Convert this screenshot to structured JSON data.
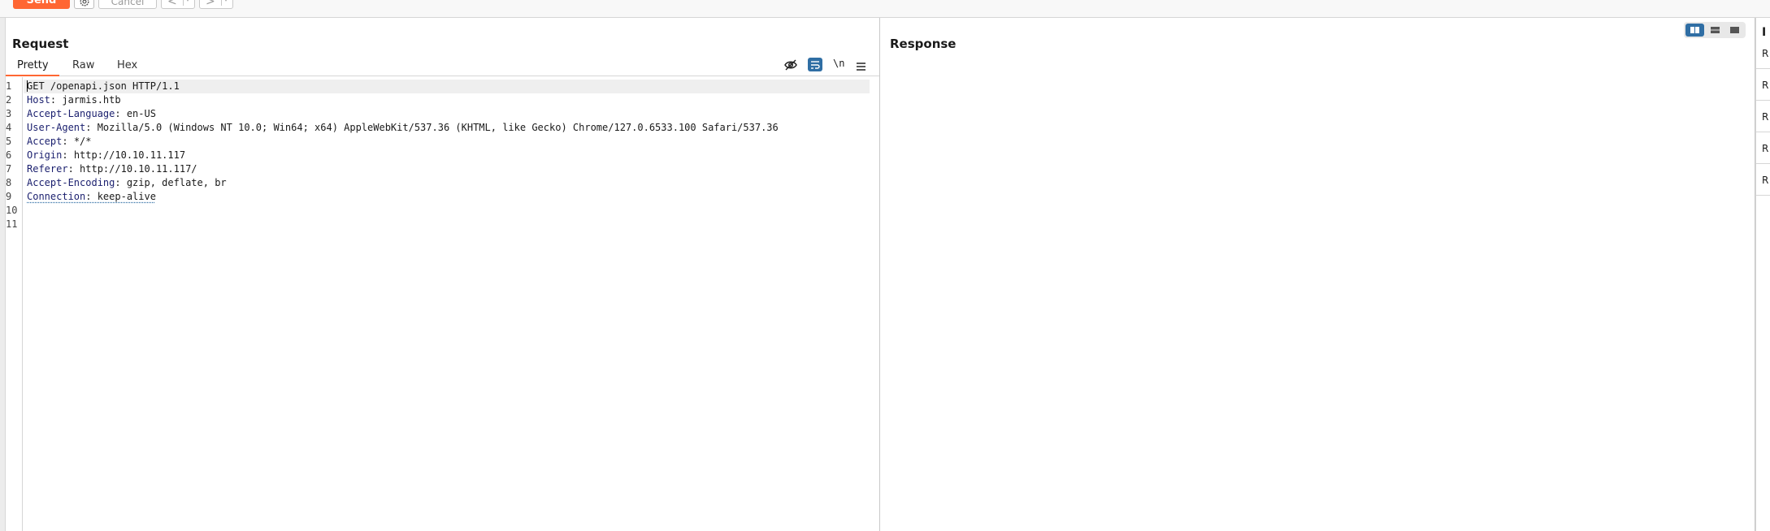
{
  "toolbar": {
    "send_label": "Send",
    "cancel_label": "Cancel",
    "back_glyph": "<",
    "forward_glyph": ">",
    "dropdown_glyph": "▾",
    "settings_icon": "gear-icon",
    "accent_color": "#ff6633"
  },
  "request": {
    "title": "Request",
    "tabs": [
      {
        "label": "Pretty",
        "active": true
      },
      {
        "label": "Raw",
        "active": false
      },
      {
        "label": "Hex",
        "active": false
      }
    ],
    "editor_icons": [
      "hide-eye-icon",
      "wrap-lines-icon",
      "newline-toggle",
      "menu-icon"
    ],
    "newline_label": "\\n",
    "line_numbers": [
      "1",
      "2",
      "3",
      "4",
      "5",
      "6",
      "7",
      "8",
      "9",
      "10",
      "11"
    ],
    "request_line": "GET /openapi.json HTTP/1.1",
    "headers": [
      {
        "name": "Host",
        "value": "jarmis.htb"
      },
      {
        "name": "Accept-Language",
        "value": "en-US"
      },
      {
        "name": "User-Agent",
        "value": "Mozilla/5.0 (Windows NT 10.0; Win64; x64) AppleWebKit/537.36 (KHTML, like Gecko) Chrome/127.0.6533.100 Safari/537.36"
      },
      {
        "name": "Accept",
        "value": "*/*"
      },
      {
        "name": "Origin",
        "value": "http://10.10.11.117"
      },
      {
        "name": "Referer",
        "value": "http://10.10.11.117/"
      },
      {
        "name": "Accept-Encoding",
        "value": "gzip, deflate, br"
      },
      {
        "name": "Connection",
        "value": "keep-alive"
      }
    ]
  },
  "response": {
    "title": "Response"
  },
  "layout_toggle": {
    "options": [
      "side-by-side-icon",
      "stacked-icon",
      "single-icon"
    ],
    "active": "side-by-side-icon",
    "active_color": "#2f6ea4"
  },
  "inspector": {
    "head": "I",
    "rows": [
      "R",
      "R",
      "R",
      "R",
      "R"
    ]
  }
}
